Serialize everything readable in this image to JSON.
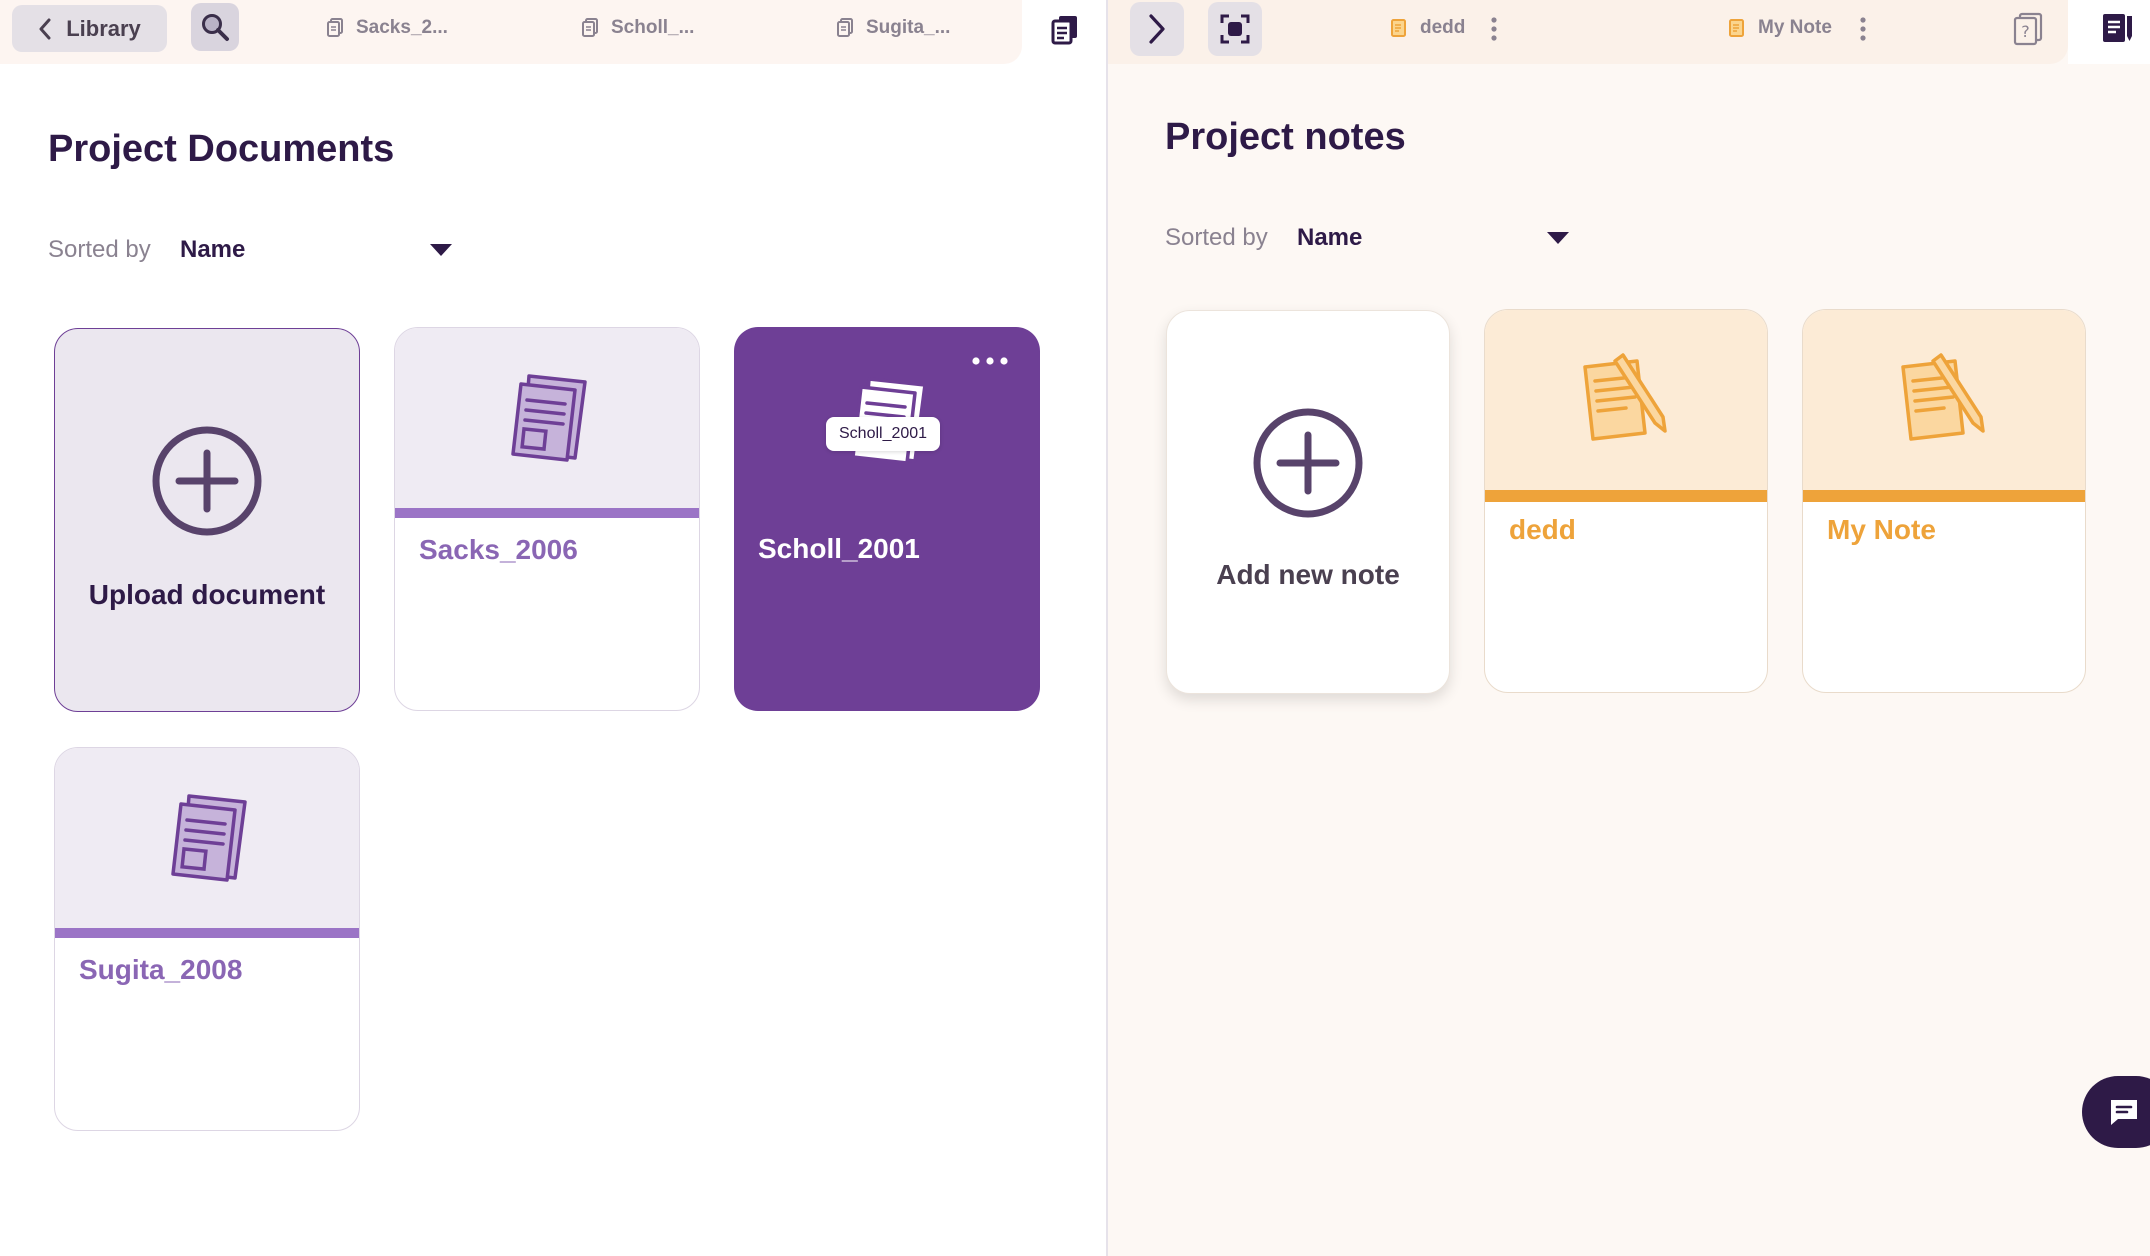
{
  "left_tabbar": {
    "back_label": "Library",
    "tabs": [
      {
        "label": "Sacks_2..."
      },
      {
        "label": "Scholl_..."
      },
      {
        "label": "Sugita_..."
      }
    ]
  },
  "right_tabbar": {
    "tabs": [
      {
        "label": "dedd"
      },
      {
        "label": "My Note"
      }
    ]
  },
  "documents": {
    "title": "Project Documents",
    "sort_label": "Sorted by",
    "sort_value": "Name",
    "upload_label": "Upload document",
    "items": [
      {
        "name": "Sacks_2006"
      },
      {
        "name": "Scholl_2001",
        "tooltip": "Scholl_2001"
      },
      {
        "name": "Sugita_2008"
      }
    ]
  },
  "notes": {
    "title": "Project notes",
    "sort_label": "Sorted by",
    "sort_value": "Name",
    "add_label": "Add new note",
    "items": [
      {
        "name": "dedd"
      },
      {
        "name": "My Note"
      }
    ]
  },
  "colors": {
    "brand_purple": "#6e3f96",
    "dark_text": "#2e1a47",
    "note_orange": "#eea33a"
  },
  "icons": {
    "back": "chevron-left-icon",
    "search": "search-icon",
    "document": "document-icon",
    "library": "documents-stack-icon",
    "expand": "chevron-right-icon",
    "focus": "fullscreen-icon",
    "note": "note-icon",
    "more": "more-vertical-icon",
    "help": "help-icon",
    "chat": "chat-icon"
  }
}
